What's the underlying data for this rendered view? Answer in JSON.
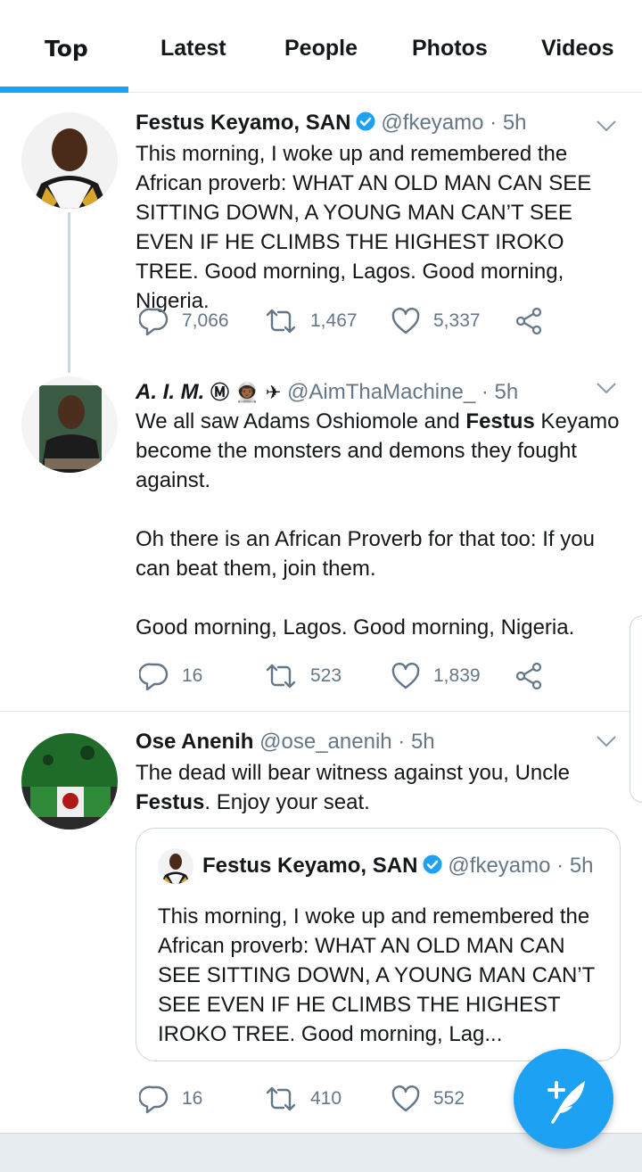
{
  "tabs": [
    {
      "label": "Top"
    },
    {
      "label": "Latest"
    },
    {
      "label": "People"
    },
    {
      "label": "Photos"
    },
    {
      "label": "Videos"
    }
  ],
  "tweets": [
    {
      "name": "Festus Keyamo, SAN",
      "handle": "@fkeyamo",
      "time": "· 5h",
      "verified": true,
      "text": "This morning, I woke up and remembered the African proverb: WHAT AN OLD MAN CAN SEE SITTING DOWN, A YOUNG MAN CAN’T SEE EVEN IF HE CLIMBS THE HIGHEST IROKO TREE. Good morning, Lagos. Good morning, Nigeria.",
      "replies": "7,066",
      "retweets": "1,467",
      "likes": "5,337"
    },
    {
      "name": "A. I. M.",
      "name_symbols": "Ⓜ 👨🏾‍🚀 ✈",
      "handle": "@AimThaMachine_",
      "time": "· 5h",
      "text_p1_a": "We all saw Adams Oshiomole and ",
      "text_p1_bold": "Festus",
      "text_p1_b": " Keyamo become the monsters and demons they fought against.",
      "text_p2": "Oh there is an African Proverb for that too: If you can beat them, join them.",
      "text_p3": "Good morning, Lagos. Good morning, Nigeria.",
      "replies": "16",
      "retweets": "523",
      "likes": "1,839"
    },
    {
      "name": "Ose Anenih",
      "handle": "@ose_anenih",
      "time": "· 5h",
      "text_a": "The dead will bear witness against you, Uncle ",
      "text_bold": "Festus",
      "text_b": ". Enjoy your seat.",
      "quote": {
        "name": "Festus Keyamo, SAN",
        "handle": "@fkeyamo",
        "time": "· 5h",
        "text": "This morning, I woke up and remembered the African proverb: WHAT AN OLD MAN CAN SEE SITTING DOWN, A YOUNG MAN CAN’T SEE EVEN IF HE CLIMBS THE HIGHEST IROKO TREE. Good morning, Lag..."
      },
      "replies": "16",
      "retweets": "410",
      "likes": "552"
    }
  ],
  "colors": {
    "accent": "#1da1f2",
    "text": "#14171a",
    "muted": "#657786",
    "border": "#e1e8ed"
  }
}
